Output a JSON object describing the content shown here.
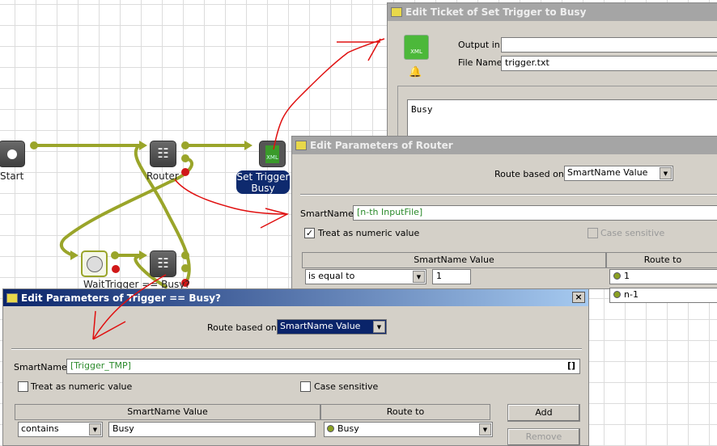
{
  "canvas": {
    "nodes": {
      "start": "Start",
      "router": "Router",
      "set_trigger": "Set Trigger",
      "set_trigger_line2": "Busy",
      "wait": "Wait",
      "trigger_busy": "Trigger == Busy?"
    },
    "wire_color": "#9aa52a",
    "annotation_color": "#e01010"
  },
  "ticket_dialog": {
    "title": "Edit Ticket of Set Trigger to Busy",
    "output_in_label": "Output in:",
    "output_in_value": "",
    "file_name_label": "File Name:",
    "file_name_value": "trigger.txt",
    "content": "Busy",
    "icon": "xml-file-icon"
  },
  "router_dialog": {
    "title": "Edit Parameters of Router",
    "route_based_on_label": "Route based on:",
    "route_based_on_value": "SmartName Value",
    "smartname_label": "SmartName:",
    "smartname_value": "[n-th InputFile]",
    "treat_numeric_label": "Treat as numeric value",
    "treat_numeric_checked": true,
    "case_sensitive_label": "Case sensitive",
    "case_sensitive_checked": false,
    "col_value": "SmartName Value",
    "col_route": "Route to",
    "rows": [
      {
        "op": "is equal to",
        "value": "1",
        "route": "1"
      },
      {
        "route": "n-1"
      }
    ]
  },
  "trigger_dialog": {
    "title": "Edit Parameters of Trigger == Busy?",
    "route_based_on_label": "Route based on:",
    "route_based_on_value": "SmartName Value",
    "smartname_label": "SmartName:",
    "smartname_value": "[Trigger_TMP]",
    "smartname_button": "[]",
    "treat_numeric_label": "Treat as numeric value",
    "treat_numeric_checked": false,
    "case_sensitive_label": "Case sensitive",
    "case_sensitive_checked": false,
    "col_value": "SmartName Value",
    "col_route": "Route to",
    "rows": [
      {
        "op": "contains",
        "value": "Busy",
        "route": "Busy"
      }
    ],
    "add_label": "Add",
    "remove_label": "Remove",
    "close": "×"
  }
}
